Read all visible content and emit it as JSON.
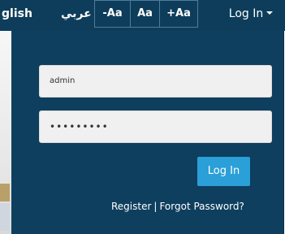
{
  "topbar": {
    "lang_english": "glish",
    "lang_arabic": "عربي",
    "font_decrease": "-Aa",
    "font_normal": "Aa",
    "font_increase": "+Aa",
    "login_toggle": "Log In"
  },
  "login": {
    "username_value": "admin",
    "password_value": "•••••••••",
    "submit_label": "Log In",
    "register_link": "Register",
    "separator": "|",
    "forgot_link": "Forgot Password?"
  },
  "colors": {
    "topbar_bg": "#0d3d5b",
    "dropdown_bg": "#0e3f5f",
    "submit_bg": "#2a9fd8"
  }
}
